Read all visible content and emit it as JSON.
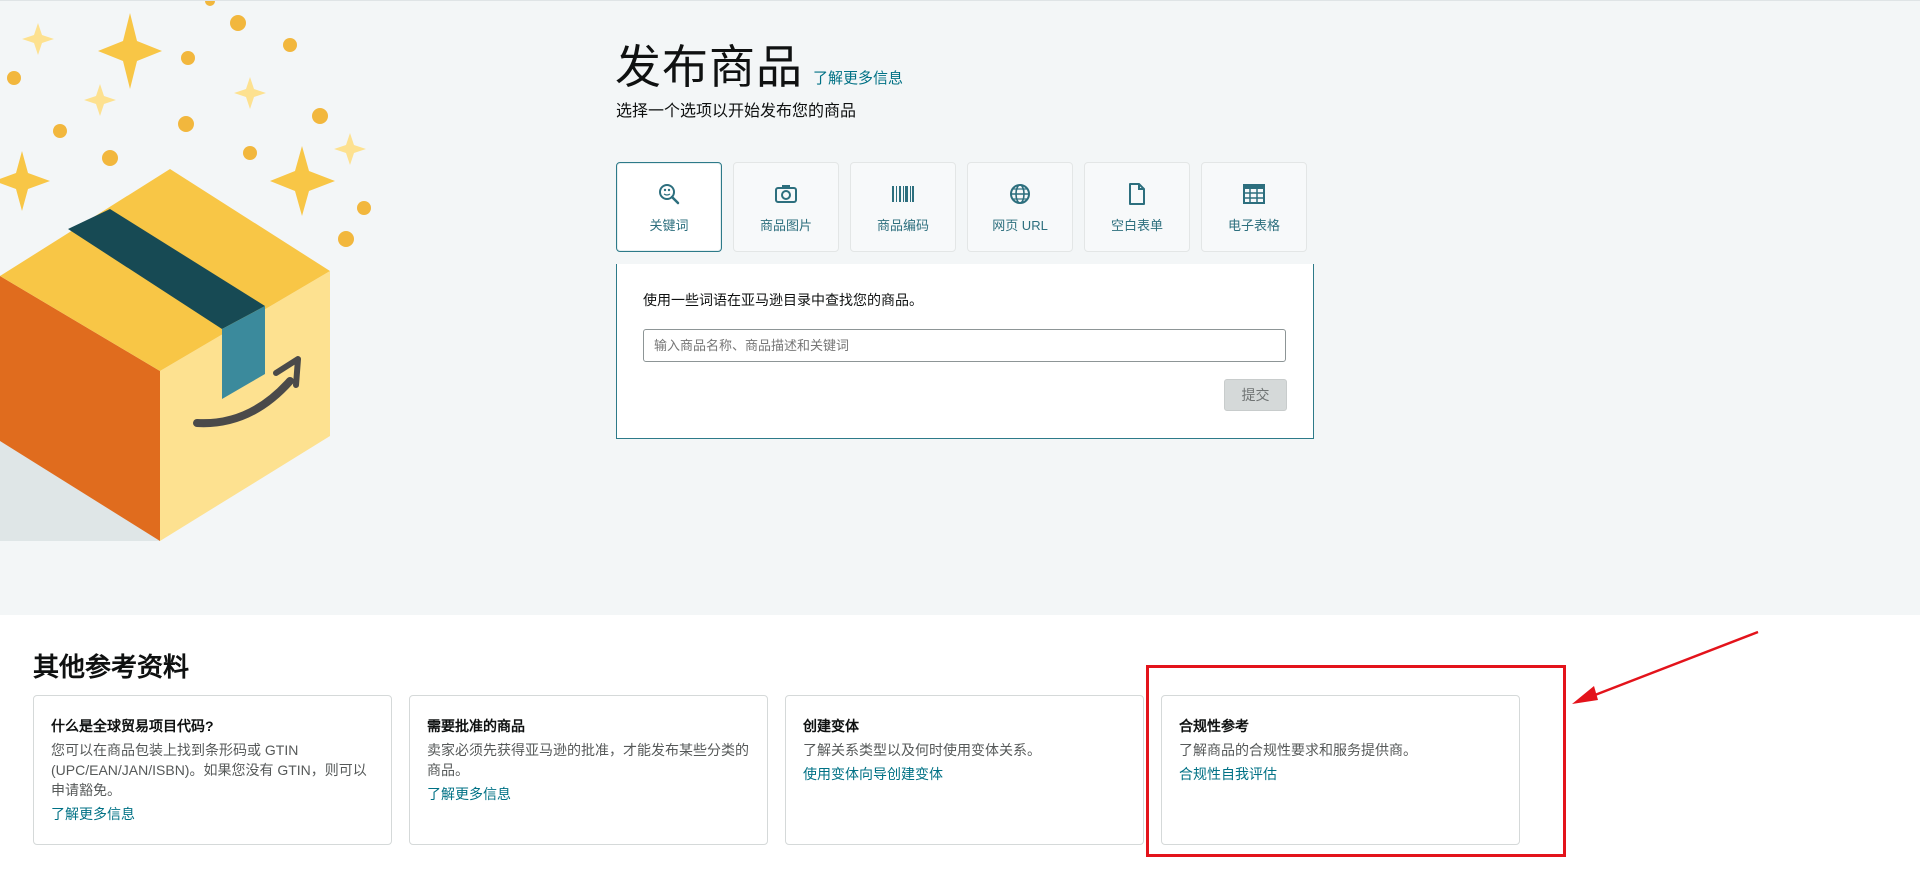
{
  "header": {
    "title": "发布商品",
    "learn_more": "了解更多信息",
    "subtitle": "选择一个选项以开始发布您的商品"
  },
  "tabs": [
    {
      "label": "关键词",
      "icon": "keyword-search-icon",
      "active": true
    },
    {
      "label": "商品图片",
      "icon": "camera-icon",
      "active": false
    },
    {
      "label": "商品编码",
      "icon": "barcode-icon",
      "active": false
    },
    {
      "label": "网页 URL",
      "icon": "globe-icon",
      "active": false
    },
    {
      "label": "空白表单",
      "icon": "document-icon",
      "active": false
    },
    {
      "label": "电子表格",
      "icon": "spreadsheet-icon",
      "active": false
    }
  ],
  "panel": {
    "description": "使用一些词语在亚马逊目录中查找您的商品。",
    "input_placeholder": "输入商品名称、商品描述和关键词",
    "input_value": "",
    "submit_label": "提交"
  },
  "references": {
    "title": "其他参考资料",
    "cards": [
      {
        "heading": "什么是全球贸易项目代码?",
        "body": "您可以在商品包装上找到条形码或 GTIN (UPC/EAN/JAN/ISBN)。如果您没有 GTIN，则可以申请豁免。",
        "link": "了解更多信息"
      },
      {
        "heading": "需要批准的商品",
        "body": "卖家必须先获得亚马逊的批准，才能发布某些分类的商品。",
        "link": "了解更多信息"
      },
      {
        "heading": "创建变体",
        "body": "了解关系类型以及何时使用变体关系。",
        "link": "使用变体向导创建变体"
      },
      {
        "heading": "合规性参考",
        "body": "了解商品的合规性要求和服务提供商。",
        "link": "合规性自我评估"
      }
    ]
  },
  "colors": {
    "accent": "#007185",
    "tab_text": "#2d6f7e",
    "hero_bg": "#f3f6f7",
    "annotation_red": "#e3131b",
    "box_orange": "#e06c1e",
    "box_yellow": "#f8c646",
    "box_light": "#fde190",
    "tape_dark": "#174a54",
    "tape_light": "#3b8a9c"
  }
}
